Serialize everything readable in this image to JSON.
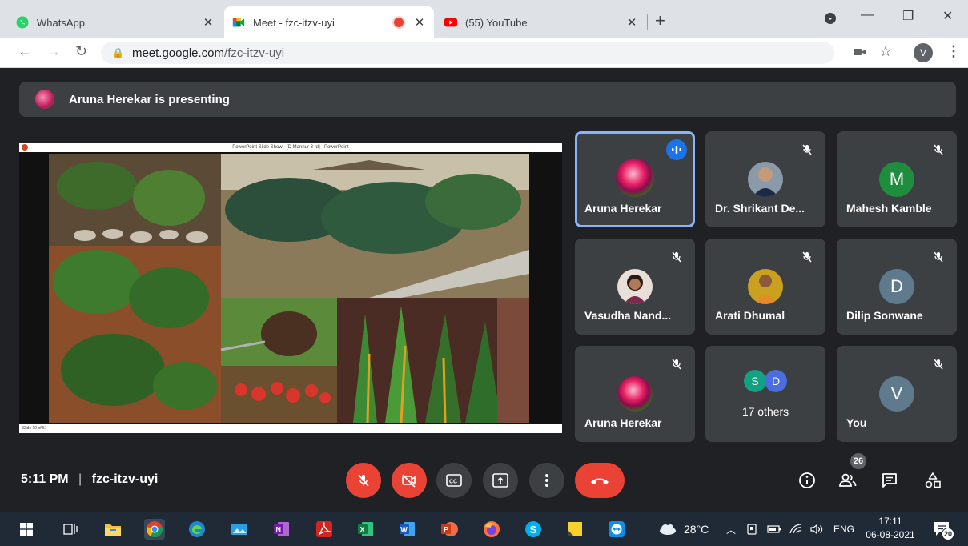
{
  "browser": {
    "tabs": [
      {
        "label": "WhatsApp",
        "icon": "whatsapp-icon"
      },
      {
        "label": "Meet - fzc-itzv-uyi",
        "icon": "meet-icon",
        "recording": true
      },
      {
        "label": "(55) YouTube",
        "icon": "youtube-icon"
      }
    ],
    "url_host": "meet.google.com",
    "url_path": "/fzc-itzv-uyi",
    "profile_initial": "V"
  },
  "meet": {
    "presenting_banner": "Aruna Herekar is presenting",
    "ppt_title": "PowerPoint Slide Show - [D Mannur 3 rd] - PowerPoint",
    "ppt_footer": "Slide 10 of 51",
    "participants": [
      {
        "name": "Aruna Herekar",
        "avatar": "photo",
        "initial": "",
        "speaking": true,
        "muted": false
      },
      {
        "name": "Dr. Shrikant De...",
        "avatar": "photo",
        "initial": "",
        "speaking": false,
        "muted": true
      },
      {
        "name": "Mahesh Kamble",
        "avatar": "letter",
        "initial": "M",
        "color": "#1e8e3e",
        "muted": true
      },
      {
        "name": "Vasudha Nand...",
        "avatar": "photo",
        "initial": "",
        "muted": true
      },
      {
        "name": "Arati Dhumal",
        "avatar": "photo",
        "initial": "",
        "muted": true
      },
      {
        "name": "Dilip Sonwane",
        "avatar": "letter",
        "initial": "D",
        "color": "#5f7a8c",
        "muted": true
      },
      {
        "name": "Aruna Herekar",
        "avatar": "photo",
        "initial": "",
        "muted": true
      },
      {
        "name": "17 others",
        "avatar": "group",
        "initials": [
          "S",
          "D"
        ],
        "muted": false
      },
      {
        "name": "You",
        "avatar": "letter",
        "initial": "V",
        "color": "#5f7a8c",
        "muted": true
      }
    ],
    "time": "5:11 PM",
    "separator": "|",
    "meeting_code": "fzc-itzv-uyi",
    "people_count": "26",
    "colors": {
      "accent": "#8ab4f8",
      "danger": "#ea4335",
      "tile": "#3c4043",
      "background": "#202124"
    }
  },
  "taskbar": {
    "temperature": "28°C",
    "language": "ENG",
    "time": "17:11",
    "date": "06-08-2021",
    "notifications": "20"
  }
}
